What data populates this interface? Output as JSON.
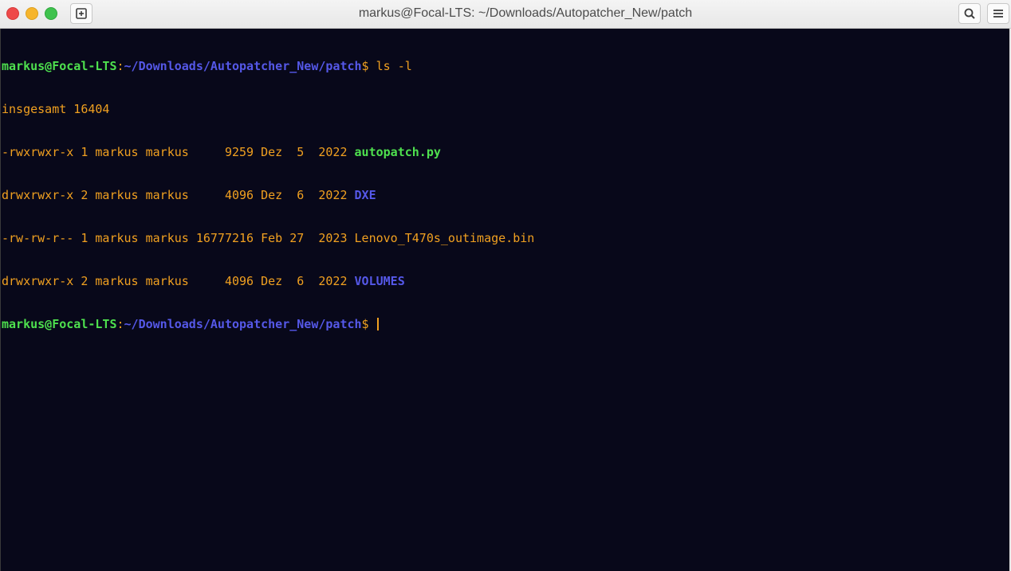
{
  "window": {
    "title": "markus@Focal-LTS: ~/Downloads/Autopatcher_New/patch"
  },
  "toolbar": {
    "close_icon": "close-circle",
    "minimize_icon": "minimize-circle",
    "maximize_icon": "maximize-circle",
    "new_tab_icon": "new-tab-icon",
    "search_icon": "search-icon",
    "menu_icon": "hamburger-menu-icon"
  },
  "terminal": {
    "prompt": {
      "user_host": "markus@Focal-LTS",
      "separator": ":",
      "path": "~/Downloads/Autopatcher_New/patch",
      "symbol": "$"
    },
    "command": " ls -l",
    "total_line": "insgesamt 16404",
    "entries": [
      {
        "meta": "-rwxrwxr-x 1 markus markus     9259 Dez  5  2022 ",
        "name": "autopatch.py",
        "kind": "exec"
      },
      {
        "meta": "drwxrwxr-x 2 markus markus     4096 Dez  6  2022 ",
        "name": "DXE",
        "kind": "dir"
      },
      {
        "meta": "-rw-rw-r-- 1 markus markus 16777216 Feb 27  2023 ",
        "name": "Lenovo_T470s_outimage.bin",
        "kind": "file"
      },
      {
        "meta": "drwxrwxr-x 2 markus markus     4096 Dez  6  2022 ",
        "name": "VOLUMES",
        "kind": "dir"
      }
    ]
  },
  "colors": {
    "background": "#08081a",
    "text": "#f0a020",
    "user_host": "#4ee04e",
    "path": "#5558e8"
  }
}
